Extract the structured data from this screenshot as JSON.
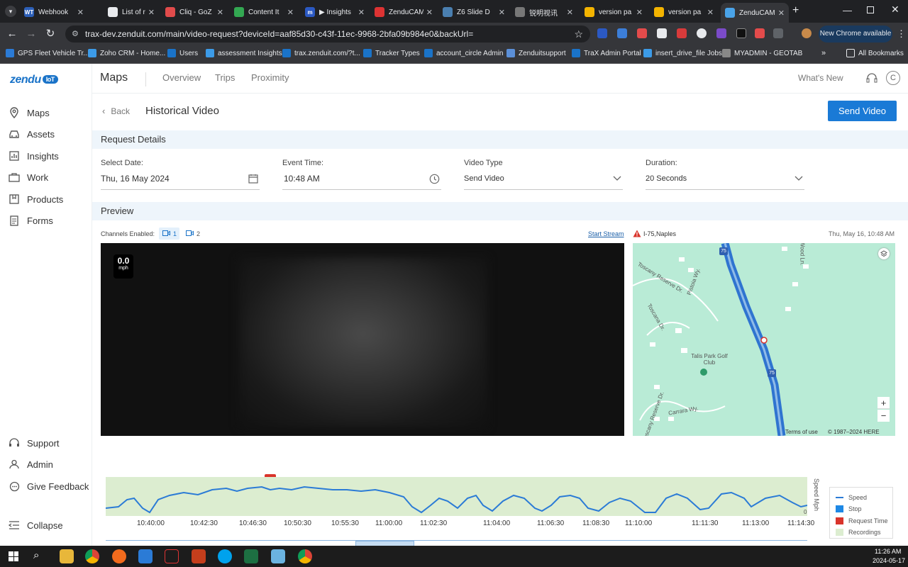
{
  "browser": {
    "tabs": [
      {
        "label": "Webhook",
        "fav": "WT",
        "color": "#2c5fb8"
      },
      {
        "label": "List of rule",
        "fav": "",
        "color": "#e8eaed"
      },
      {
        "label": "Cliq - GoZ",
        "fav": "",
        "color": "#e14b4b"
      },
      {
        "label": "Content It",
        "fav": "",
        "color": "#33a852"
      },
      {
        "label": "▶ Insights",
        "fav": "m",
        "color": "#2b59c3"
      },
      {
        "label": "ZenduCAM",
        "fav": "",
        "color": "#d33"
      },
      {
        "label": "Z6 Slide D",
        "fav": "",
        "color": "#4a7fb0"
      },
      {
        "label": "锐明视讯",
        "fav": "",
        "color": "#777"
      },
      {
        "label": "version pa",
        "fav": "",
        "color": "#f4b400"
      },
      {
        "label": "version pa",
        "fav": "",
        "color": "#f4b400"
      },
      {
        "label": "ZenduCAM",
        "fav": "",
        "color": "#4aa3e8"
      }
    ],
    "url": "trax-dev.zenduit.com/main/video-request?deviceId=aaf85d30-c43f-11ec-9968-2bfa09b984e0&backUrl=",
    "new_chrome": "New Chrome available",
    "bookmarks": [
      "GPS Fleet Vehicle Tr...",
      "Zoho CRM - Home...",
      "Users",
      "assessment Insights",
      "trax.zenduit.com/?t...",
      "Tracker Types",
      "account_circle Admin",
      "Zenduitsupport",
      "TraX Admin Portal",
      "insert_drive_file Jobs",
      "MYADMIN - GEOTAB"
    ],
    "all_bookmarks": "All Bookmarks"
  },
  "app": {
    "logo": "zendu",
    "logo_badge": "IoT",
    "sidebar": {
      "items": [
        "Maps",
        "Assets",
        "Insights",
        "Work",
        "Products",
        "Forms"
      ],
      "bottom": [
        "Support",
        "Admin",
        "Give Feedback"
      ],
      "collapse": "Collapse"
    },
    "topnav": {
      "title": "Maps",
      "tabs": [
        "Overview",
        "Trips",
        "Proximity"
      ],
      "whats_new": "What's New",
      "avatar": "C"
    },
    "page": {
      "back": "Back",
      "title": "Historical Video",
      "send": "Send Video"
    },
    "request": {
      "section": "Request Details",
      "date_label": "Select Date:",
      "date_value": "Thu, 16 May 2024",
      "time_label": "Event Time:",
      "time_value": "10:48 AM",
      "type_label": "Video Type",
      "type_value": "Send Video",
      "duration_label": "Duration:",
      "duration_value": "20 Seconds"
    },
    "preview": {
      "section": "Preview",
      "channels_label": "Channels Enabled:",
      "channel1": "1",
      "channel2": "2",
      "start_stream": "Start Stream",
      "speed": "0.0",
      "speed_unit": "mph",
      "location": "I-75,Naples",
      "timestamp": "Thu, May 16, 10:48 AM",
      "map_labels": [
        "Toscany Reserve Dr.",
        "Pistoia Wy.",
        "Toscana Dr.",
        "Talis Park Golf Club",
        "Carrara Wy.",
        "Toscany Reserve Dr.",
        "Wood Ln."
      ],
      "hwy": "75",
      "zoom_in": "+",
      "zoom_out": "−",
      "terms": "Terms of use",
      "copyright": "© 1987–2024 HERE"
    },
    "timeline": {
      "marker": "R",
      "ylabel": "Speed Mph",
      "ymax": "0",
      "ticks": [
        "10:40:00",
        "10:42:30",
        "10:46:30",
        "10:50:30",
        "10:55:30",
        "11:00:00",
        "11:02:30",
        "11:04:00",
        "11:06:30",
        "11:08:30",
        "11:10:00",
        "11:11:30",
        "11:13:00",
        "11:14:30"
      ],
      "legend": [
        "Speed",
        "Stop",
        "Request Time",
        "Recordings"
      ],
      "colors": {
        "speed": "#2b7bd6",
        "stop": "#1e88e5",
        "request": "#d9342b",
        "recordings": "#dcedd0"
      }
    }
  },
  "taskbar": {
    "time": "11:26 AM",
    "date": "2024-05-17"
  }
}
